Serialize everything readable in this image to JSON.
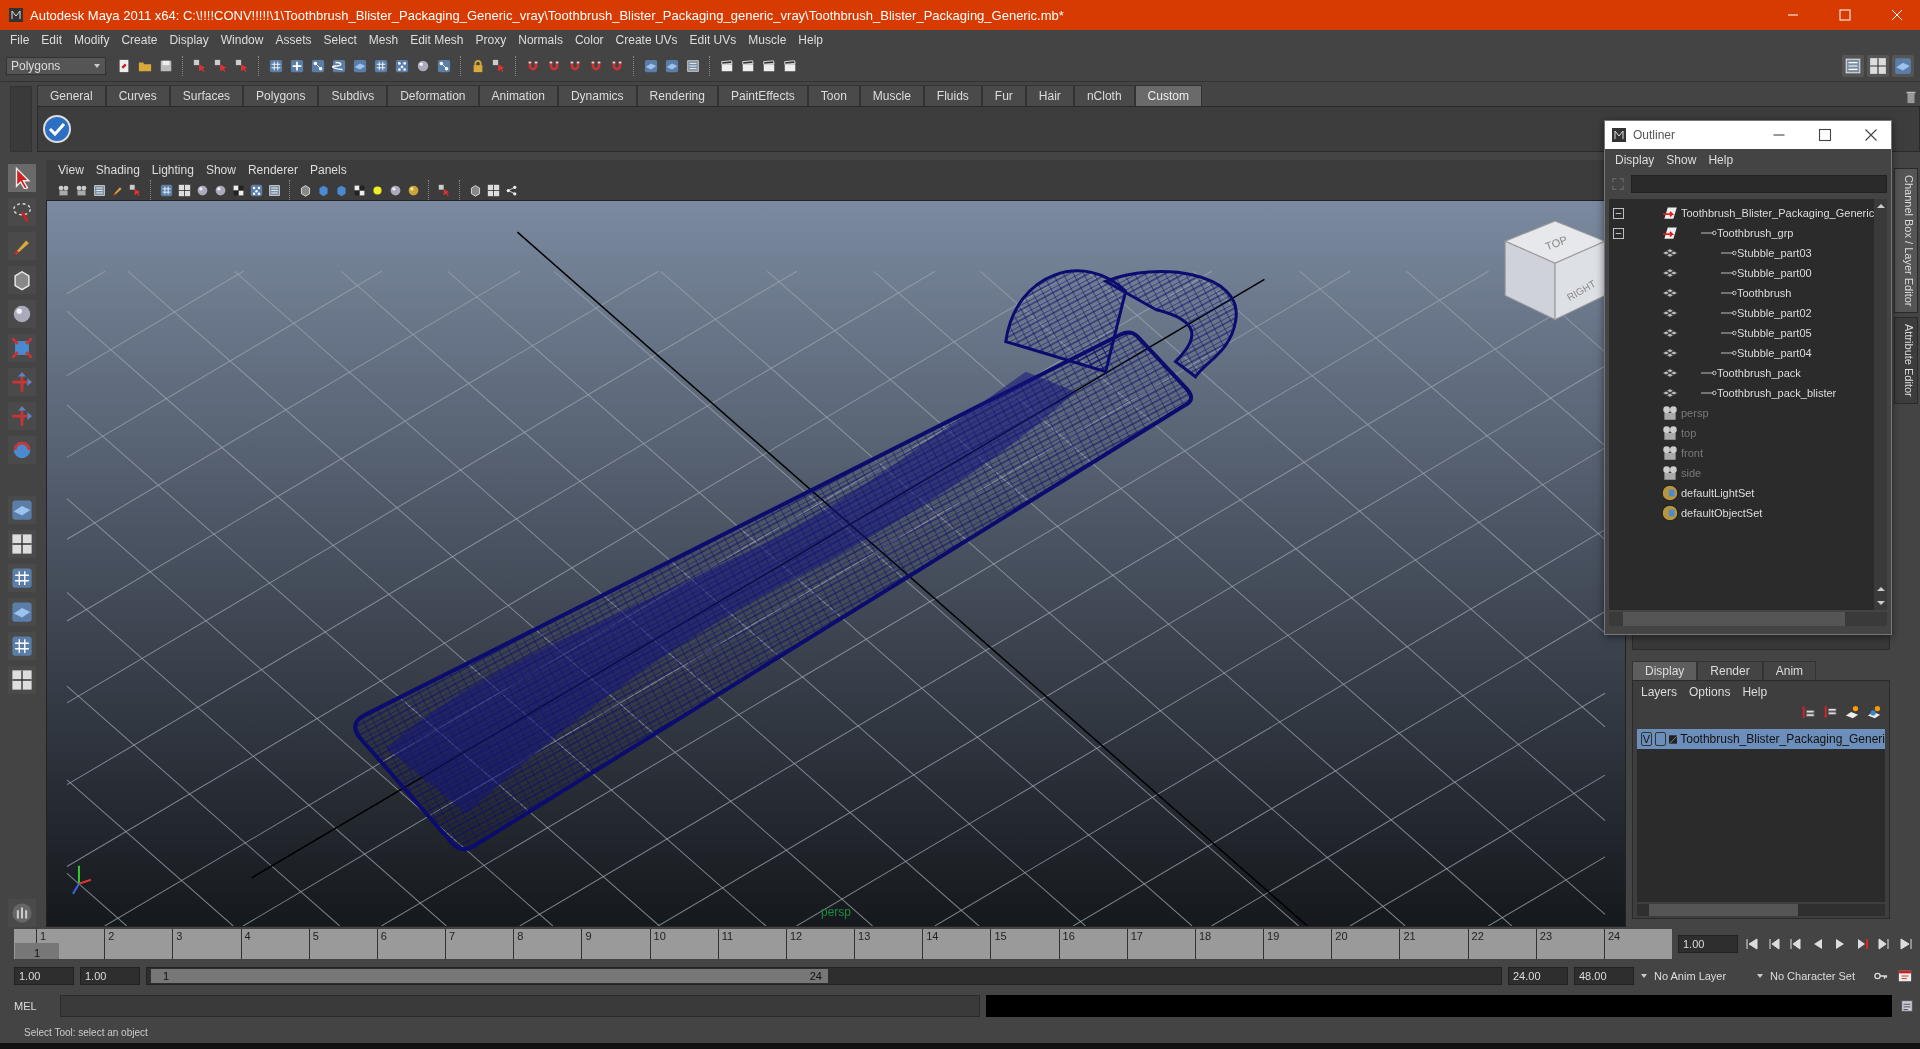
{
  "window": {
    "title": "Autodesk Maya 2011 x64: C:\\!!!!CONV!!!!!\\1\\Toothbrush_Blister_Packaging_Generic_vray\\Toothbrush_Blister_Packaging_generic_vray\\Toothbrush_Blister_Packaging_Generic.mb*"
  },
  "menu_bar": [
    "File",
    "Edit",
    "Modify",
    "Create",
    "Display",
    "Window",
    "Assets",
    "Select",
    "Mesh",
    "Edit Mesh",
    "Proxy",
    "Normals",
    "Color",
    "Create UVs",
    "Edit UVs",
    "Muscle",
    "Help"
  ],
  "status_line": {
    "menu_set": "Polygons"
  },
  "shelf_tabs": [
    {
      "label": "General",
      "selected": false
    },
    {
      "label": "Curves",
      "selected": false
    },
    {
      "label": "Surfaces",
      "selected": false
    },
    {
      "label": "Polygons",
      "selected": false
    },
    {
      "label": "Subdivs",
      "selected": false
    },
    {
      "label": "Deformation",
      "selected": false
    },
    {
      "label": "Animation",
      "selected": false
    },
    {
      "label": "Dynamics",
      "selected": false
    },
    {
      "label": "Rendering",
      "selected": false
    },
    {
      "label": "PaintEffects",
      "selected": false
    },
    {
      "label": "Toon",
      "selected": false
    },
    {
      "label": "Muscle",
      "selected": false
    },
    {
      "label": "Fluids",
      "selected": false
    },
    {
      "label": "Fur",
      "selected": false
    },
    {
      "label": "Hair",
      "selected": false
    },
    {
      "label": "nCloth",
      "selected": false
    },
    {
      "label": "Custom",
      "selected": true
    }
  ],
  "viewport": {
    "menu": [
      "View",
      "Shading",
      "Lighting",
      "Show",
      "Renderer",
      "Panels"
    ],
    "view_cube": [
      "TOP",
      "RIGHT"
    ],
    "camera_label": "persp"
  },
  "outliner": {
    "title": "Outliner",
    "menu": [
      "Display",
      "Show",
      "Help"
    ],
    "items": [
      {
        "label": "Toothbrush_Blister_Packaging_Generic",
        "kind": "transform",
        "dimmed": false,
        "expanded": true,
        "children": [
          {
            "label": "Toothbrush_grp",
            "kind": "transform",
            "dimmed": false,
            "expanded": true,
            "children": [
              {
                "label": "Stubble_part03",
                "kind": "mesh",
                "dimmed": false
              },
              {
                "label": "Stubble_part00",
                "kind": "mesh",
                "dimmed": false
              },
              {
                "label": "Toothbrush",
                "kind": "mesh",
                "dimmed": false
              },
              {
                "label": "Stubble_part02",
                "kind": "mesh",
                "dimmed": false
              },
              {
                "label": "Stubble_part05",
                "kind": "mesh",
                "dimmed": false
              },
              {
                "label": "Stubble_part04",
                "kind": "mesh",
                "dimmed": false
              }
            ]
          },
          {
            "label": "Toothbrush_pack",
            "kind": "mesh",
            "dimmed": false
          },
          {
            "label": "Toothbrush_pack_blister",
            "kind": "mesh",
            "dimmed": false
          }
        ]
      },
      {
        "label": "persp",
        "kind": "camera",
        "dimmed": true
      },
      {
        "label": "top",
        "kind": "camera",
        "dimmed": true
      },
      {
        "label": "front",
        "kind": "camera",
        "dimmed": true
      },
      {
        "label": "side",
        "kind": "camera",
        "dimmed": true
      },
      {
        "label": "defaultLightSet",
        "kind": "set",
        "dimmed": false
      },
      {
        "label": "defaultObjectSet",
        "kind": "set",
        "dimmed": false
      }
    ]
  },
  "side_tabs": [
    {
      "label": "Channel Box / Layer Editor",
      "selected": true
    },
    {
      "label": "Attribute Editor",
      "selected": false
    }
  ],
  "layer_editor": {
    "tabs": [
      {
        "label": "Display",
        "selected": true
      },
      {
        "label": "Render",
        "selected": false
      },
      {
        "label": "Anim",
        "selected": false
      }
    ],
    "menu": [
      "Layers",
      "Options",
      "Help"
    ],
    "layers": [
      {
        "visibility": "V",
        "name": "Toothbrush_Blister_Packaging_Generi",
        "selected": true
      }
    ]
  },
  "time_slider": {
    "ticks": [
      {
        "label": "1",
        "selected": true
      },
      {
        "label": "2",
        "selected": false
      },
      {
        "label": "3",
        "selected": false
      },
      {
        "label": "4",
        "selected": false
      },
      {
        "label": "5",
        "selected": false
      },
      {
        "label": "6",
        "selected": false
      },
      {
        "label": "7",
        "selected": false
      },
      {
        "label": "8",
        "selected": false
      },
      {
        "label": "9",
        "selected": false
      },
      {
        "label": "10",
        "selected": false
      },
      {
        "label": "11",
        "selected": false
      },
      {
        "label": "12",
        "selected": false
      },
      {
        "label": "13",
        "selected": false
      },
      {
        "label": "14",
        "selected": false
      },
      {
        "label": "15",
        "selected": false
      },
      {
        "label": "16",
        "selected": false
      },
      {
        "label": "17",
        "selected": false
      },
      {
        "label": "18",
        "selected": false
      },
      {
        "label": "19",
        "selected": false
      },
      {
        "label": "20",
        "selected": false
      },
      {
        "label": "21",
        "selected": false
      },
      {
        "label": "22",
        "selected": false
      },
      {
        "label": "23",
        "selected": false
      },
      {
        "label": "24",
        "selected": false
      }
    ],
    "current_frame": "1",
    "current_time": "1.00"
  },
  "range_slider": {
    "level": 0.5,
    "start_time": "1.00",
    "playback_start": "1.00",
    "range_start": "1",
    "range_end": "24",
    "playback_end": "24.00",
    "end_time": "48.00",
    "anim_layer": "No Anim Layer",
    "character_set": "No Character Set"
  },
  "command_line": {
    "label": "MEL"
  },
  "help_line": "Select Tool: select an object"
}
